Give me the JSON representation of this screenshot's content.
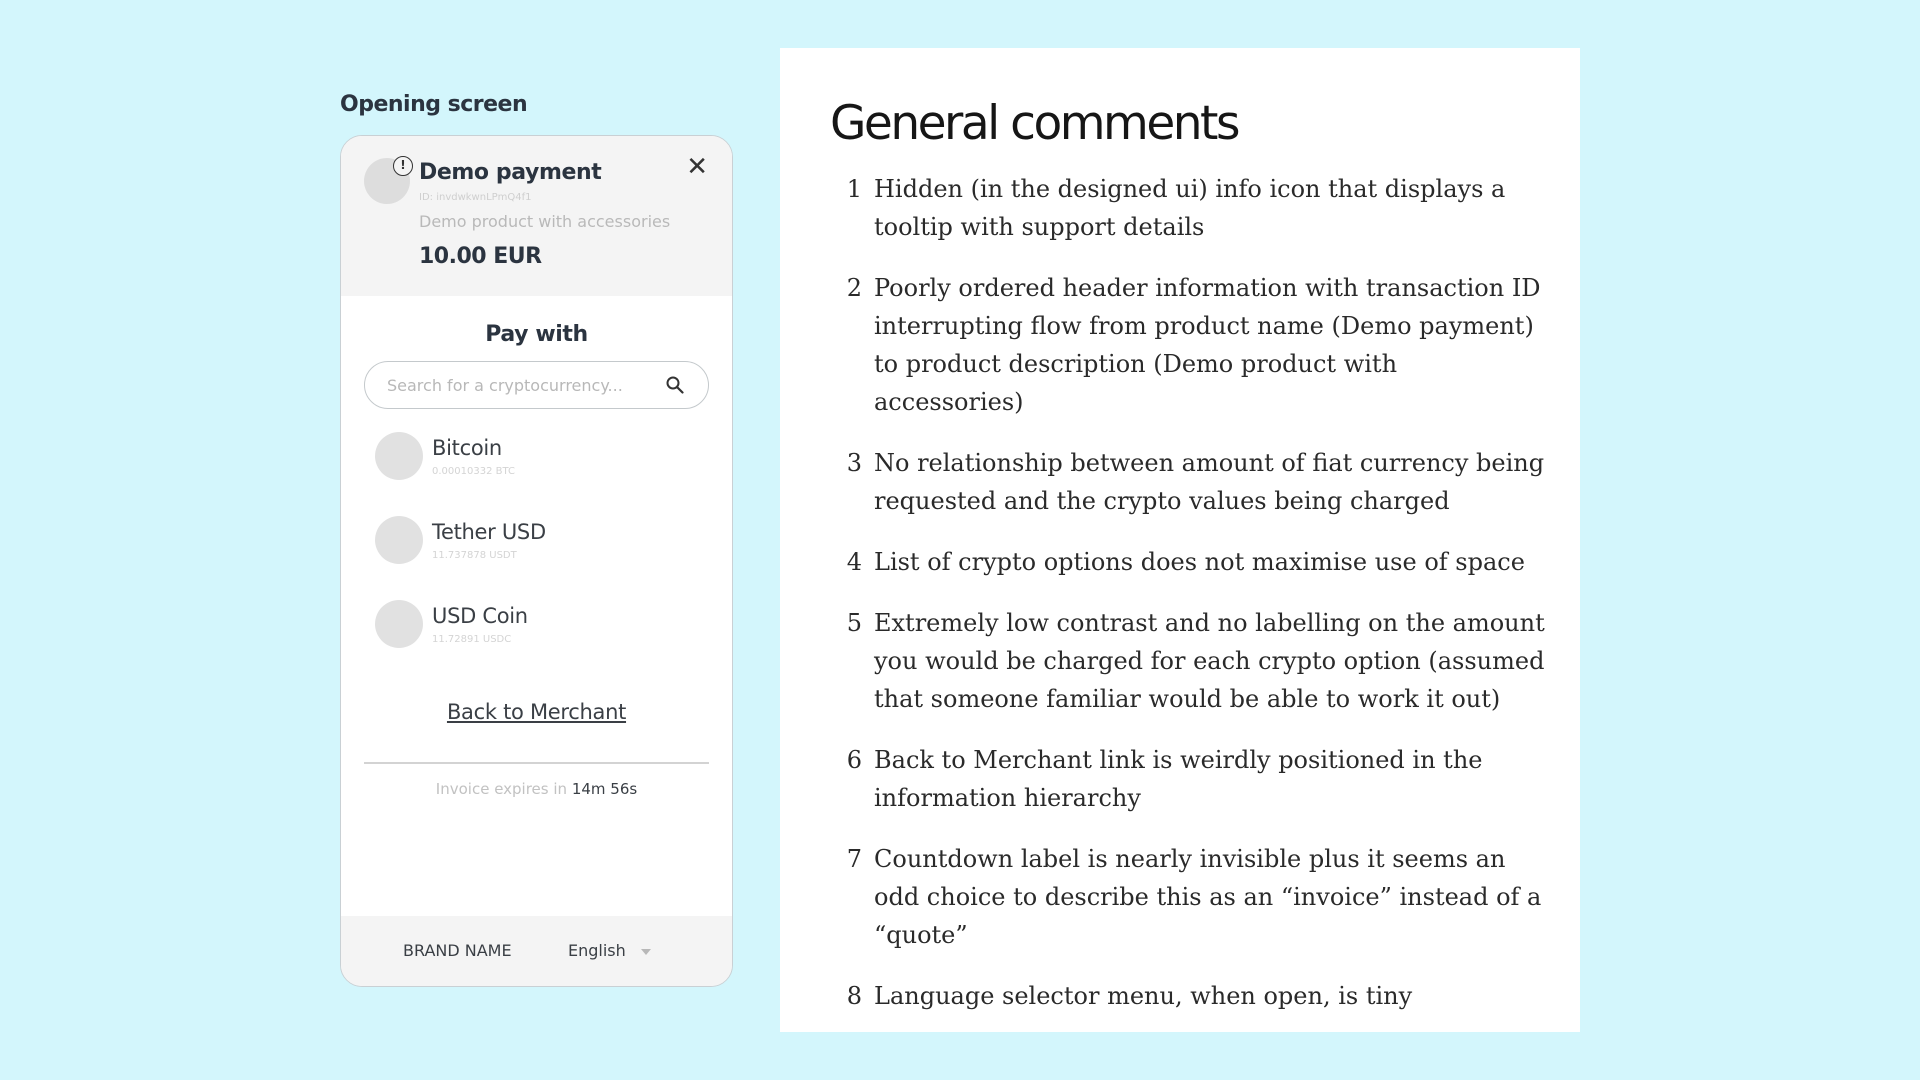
{
  "opening_label": "Opening screen",
  "payment": {
    "title": "Demo payment",
    "transaction_id": "ID: invdwkwnLPmQ4f1",
    "description": "Demo product with accessories",
    "amount": "10.00 EUR",
    "info_icon_glyph": "!",
    "close_glyph": "✕"
  },
  "pay_with": {
    "heading": "Pay with",
    "search_placeholder": "Search for a cryptocurrency..."
  },
  "coins": [
    {
      "name": "Bitcoin",
      "amount": "0.00010332 BTC"
    },
    {
      "name": "Tether USD",
      "amount": "11.737878 USDT"
    },
    {
      "name": "USD Coin",
      "amount": "11.72891 USDC"
    }
  ],
  "back_link": "Back to Merchant",
  "countdown": {
    "label": "Invoice expires in ",
    "value": "14m 56s"
  },
  "footer": {
    "brand": "BRAND NAME",
    "language": "English"
  },
  "comments_panel": {
    "title": "General comments",
    "items": [
      {
        "num": "1",
        "text": "Hidden (in the designed ui) info icon that displays a tooltip with support details"
      },
      {
        "num": "2",
        "text": "Poorly ordered header information with transaction ID interrupting flow from product name (Demo payment) to product description (Demo product with accessories)"
      },
      {
        "num": "3",
        "text": "No relationship between amount of fiat currency being requested and the crypto values being charged"
      },
      {
        "num": "4",
        "text": "List of crypto options does not maximise use of space"
      },
      {
        "num": "5",
        "text": "Extremely low contrast and no labelling on the amount you would be charged for each crypto option (assumed that someone familiar would be able to work it out)"
      },
      {
        "num": "6",
        "text": "Back to Merchant link is weirdly positioned in the information hierarchy"
      },
      {
        "num": "7",
        "text": "Countdown label is nearly invisible plus it seems an odd choice to describe this as an “invoice” instead of a “quote”"
      },
      {
        "num": "8",
        "text": "Language selector menu, when open, is tiny"
      }
    ]
  }
}
